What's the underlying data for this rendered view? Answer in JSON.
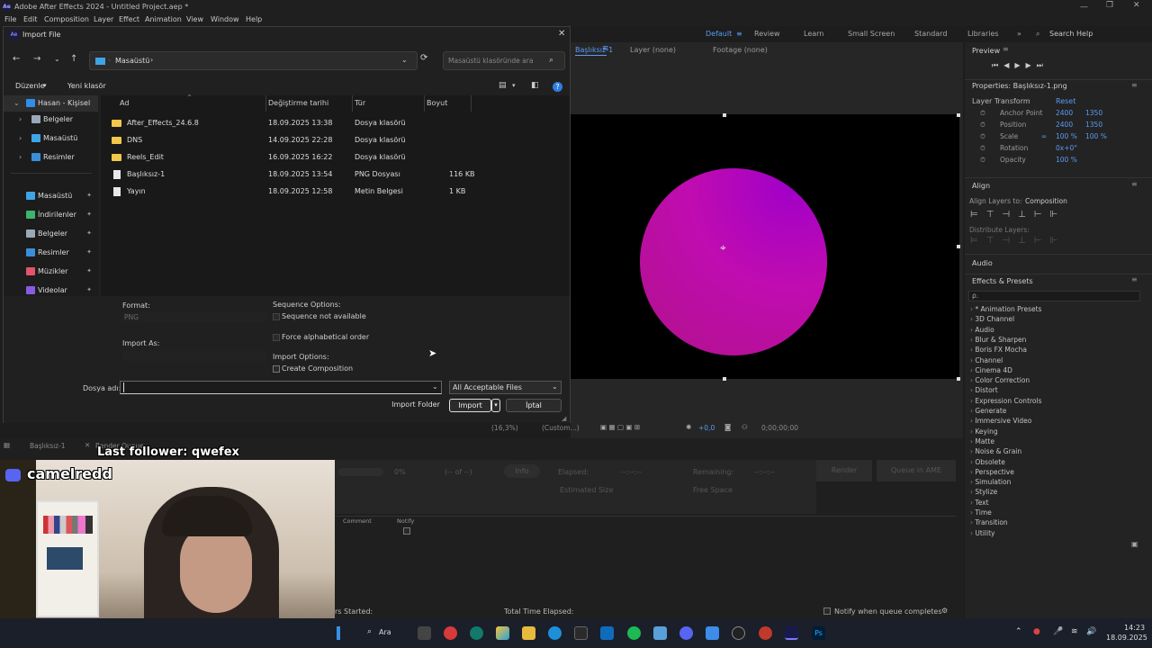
{
  "app": {
    "title": "Adobe After Effects 2024 - Untitled Project.aep *",
    "logo": "Ae"
  },
  "menu": [
    "File",
    "Edit",
    "Composition",
    "Layer",
    "Effect",
    "Animation",
    "View",
    "Window",
    "Help"
  ],
  "workspaces": [
    "Default",
    "Review",
    "Learn",
    "Small Screen",
    "Standard",
    "Libraries"
  ],
  "search_help": "Search Help",
  "comp_tabs": {
    "comp": "Başlıksız-1",
    "layer": "Layer (none)",
    "footage": "Footage (none)"
  },
  "comp_footer": {
    "zoom": "(16,3%)",
    "res": "(Custom...)",
    "exposure": "+0,0",
    "timecode": "0;00;00;00"
  },
  "preview": {
    "title": "Preview"
  },
  "properties": {
    "title": "Properties: Başlıksız-1.png",
    "section": "Layer Transform",
    "reset": "Reset",
    "rows": [
      {
        "label": "Anchor Point",
        "v1": "2400",
        "v2": "1350"
      },
      {
        "label": "Position",
        "v1": "2400",
        "v2": "1350"
      },
      {
        "label": "Scale",
        "v1": "100 %",
        "v2": "100 %"
      },
      {
        "label": "Rotation",
        "v1": "0x+0°",
        "v2": ""
      },
      {
        "label": "Opacity",
        "v1": "100 %",
        "v2": ""
      }
    ]
  },
  "align": {
    "title": "Align",
    "align_to_label": "Align Layers to:",
    "align_to": "Composition",
    "distribute": "Distribute Layers:"
  },
  "audio": {
    "title": "Audio"
  },
  "effects": {
    "title": "Effects & Presets",
    "search": "ρ.",
    "items": [
      "* Animation Presets",
      "3D Channel",
      "Audio",
      "Blur & Sharpen",
      "Boris FX Mocha",
      "Channel",
      "Cinema 4D",
      "Color Correction",
      "Distort",
      "Expression Controls",
      "Generate",
      "Immersive Video",
      "Keying",
      "Matte",
      "Noise & Grain",
      "Obsolete",
      "Perspective",
      "Simulation",
      "Stylize",
      "Text",
      "Time",
      "Transition",
      "Utility"
    ]
  },
  "render": {
    "tab1": "Başlıksız-1",
    "tab2": "Render Queue",
    "progress": "0%",
    "of": "(-- of --)",
    "info": "Info",
    "elapsed": "Elapsed:",
    "elapsed_v": "--:--:--",
    "remaining": "Remaining:",
    "remaining_v": "--:--:--",
    "est": "Estimated Size",
    "free": "Free Space",
    "render_btn": "Render",
    "queue_ame": "Queue in AME",
    "comment": "Comment",
    "notify": "Notify",
    "started": "rs Started:",
    "total": "Total Time Elapsed:",
    "notify_done": "Notify when queue completes"
  },
  "stream": {
    "follower": "Last follower: qwefex",
    "handle": "camelredd"
  },
  "taskbar": {
    "search": "Ara",
    "time": "14:23",
    "date": "18.09.2025"
  },
  "dialog": {
    "title": "Import File",
    "path": "Masaüstü",
    "search_placeholder": "Masaüstü klasöründe ara",
    "organize": "Düzenle",
    "new_folder": "Yeni klasör",
    "tree": [
      {
        "label": "Hasan - Kişisel",
        "color": "#2f8ee8",
        "pin": ""
      },
      {
        "label": "Belgeler",
        "color": "#9aa9b8",
        "pin": ""
      },
      {
        "label": "Masaüstü",
        "color": "#3fa4e6",
        "pin": ""
      },
      {
        "label": "Resimler",
        "color": "#3b8fd8",
        "pin": ""
      },
      {
        "label": "Masaüstü",
        "color": "#3fa4e6",
        "pin": "📌"
      },
      {
        "label": "İndirilenler",
        "color": "#3eb46a",
        "pin": "📌"
      },
      {
        "label": "Belgeler",
        "color": "#9aa9b8",
        "pin": "📌"
      },
      {
        "label": "Resimler",
        "color": "#3b8fd8",
        "pin": "📌"
      },
      {
        "label": "Müzikler",
        "color": "#e0556a",
        "pin": "📌"
      },
      {
        "label": "Videolar",
        "color": "#8a5ae0",
        "pin": "📌"
      }
    ],
    "columns": {
      "name": "Ad",
      "date": "Değiştirme tarihi",
      "type": "Tür",
      "size": "Boyut"
    },
    "files": [
      {
        "name": "After_Effects_24.6.8",
        "date": "18.09.2025 13:38",
        "type": "Dosya klasörü",
        "size": "",
        "kind": "folder"
      },
      {
        "name": "DNS",
        "date": "14.09.2025 22:28",
        "type": "Dosya klasörü",
        "size": "",
        "kind": "folder"
      },
      {
        "name": "Reels_Edit",
        "date": "16.09.2025 16:22",
        "type": "Dosya klasörü",
        "size": "",
        "kind": "folder"
      },
      {
        "name": "Başlıksız-1",
        "date": "18.09.2025 13:54",
        "type": "PNG Dosyası",
        "size": "116 KB",
        "kind": "file"
      },
      {
        "name": "Yayın",
        "date": "18.09.2025 12:58",
        "type": "Metin Belgesi",
        "size": "1 KB",
        "kind": "file"
      }
    ],
    "format_label": "Format:",
    "format_value": "PNG",
    "import_as_label": "Import As:",
    "seq_label": "Sequence Options:",
    "seq_na": "Sequence not available",
    "force_alpha": "Force alphabetical order",
    "import_options_label": "Import Options:",
    "create_comp": "Create Composition",
    "filename_label": "Dosya adı:",
    "filename_value": "",
    "filter": "All Acceptable Files",
    "import_folder": "Import Folder",
    "import": "Import",
    "cancel": "İptal"
  }
}
